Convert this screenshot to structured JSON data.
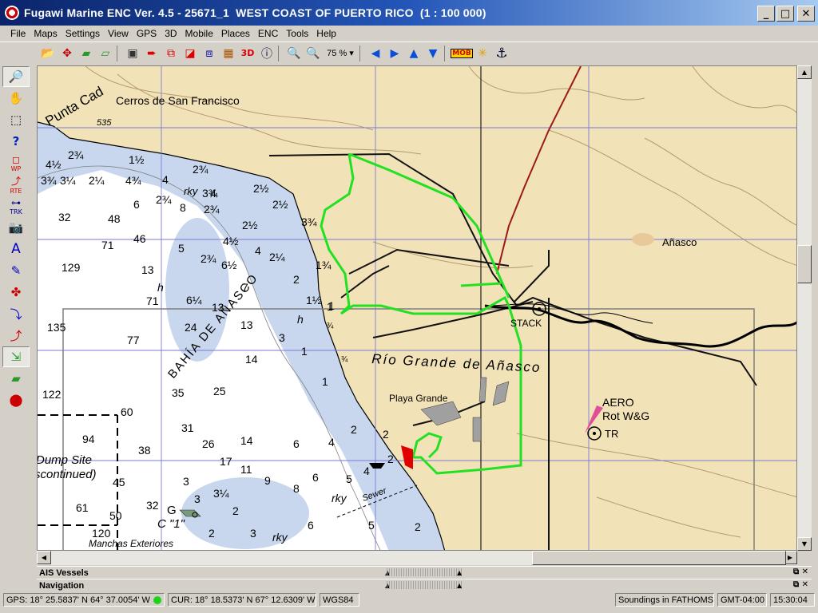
{
  "window": {
    "title": "Fugawi Marine ENC Ver. 4.5 - 25671_1  WEST COAST OF PUERTO RICO  (1 : 100 000)",
    "minimize": "_",
    "maximize": "□",
    "close": "✕"
  },
  "menu": [
    "File",
    "Maps",
    "Settings",
    "View",
    "GPS",
    "3D",
    "Mobile",
    "Places",
    "ENC",
    "Tools",
    "Help"
  ],
  "toolbar": {
    "zoom_level": "75 %",
    "zoom_caret": "▾",
    "mob_label": "MOB",
    "threed_label": "3D",
    "icons": [
      "open-folder-icon",
      "pan-cross-icon",
      "layers-icon",
      "layers-alt-icon",
      "device-icon",
      "send-red-icon",
      "route-icon",
      "waypoint-red-icon",
      "window-icon",
      "photo-icon",
      "3d-icon",
      "info-icon",
      "zoom-out-icon",
      "zoom-in-icon",
      "arrow-left-icon",
      "arrow-right-icon",
      "arrow-up-icon",
      "arrow-down-icon",
      "mob-icon",
      "spark-icon",
      "anchor-icon"
    ]
  },
  "left_tools": [
    "zoom-tool",
    "hand-tool",
    "select-tool",
    "query-tool",
    "waypoint-tool",
    "route-tool",
    "track-tool",
    "camera-tool",
    "text-tool",
    "pen-tool",
    "waypoint-add-tool",
    "route-add-tool",
    "route-edit-tool",
    "layer-tool",
    "layer2-tool",
    "gps-tool"
  ],
  "left_tool_labels": {
    "waypoint": "WP",
    "route": "RTE",
    "track": "TRK"
  },
  "map": {
    "place_names": {
      "punta": "Punta Cad",
      "cerros": "Cerros de San Francisco",
      "anasco": "Añasco",
      "rio": "Río  Grande  de  Añasco",
      "playa": "Playa Grande",
      "bahia": "BAHÍA  DE  AÑASCO",
      "stack": "STACK",
      "aero": "AERO",
      "rot": "Rot W&G",
      "tr": "TR",
      "dump1": "Dump Site",
      "dump2": "scontinued)",
      "sewer": "Sewer",
      "manchas": "Manchas Exteriores",
      "buoy_g": "G",
      "buoy_c": "C \"1\"",
      "rky1": "rky",
      "rky2": "rky",
      "rky3": "rky",
      "h1": "h",
      "h2": "h",
      "elev535": "535"
    },
    "soundings": [
      "4½",
      "2¾",
      "1½",
      "3¾",
      "3¼",
      "2¼",
      "4¾",
      "4",
      "2¾",
      "2¾",
      "32",
      "48",
      "6",
      "2¾",
      "8",
      "3¾",
      "4",
      "2½",
      "2½",
      "46",
      "71",
      "5",
      "4½",
      "2½",
      "2¾",
      "3¾",
      "129",
      "13",
      "6½",
      "4",
      "2¼",
      "1¾",
      "71",
      "7",
      "2",
      "1½",
      "1",
      "135",
      "77",
      "6¼",
      "13",
      "24",
      "13",
      "3",
      "1",
      "¾",
      "14",
      "¾",
      "122",
      "35",
      "25",
      "1",
      "60",
      "94",
      "31",
      "26",
      "14",
      "6",
      "4",
      "2",
      "2",
      "38",
      "17",
      "11",
      "45",
      "9",
      "8",
      "6",
      "5",
      "4",
      "2",
      "61",
      "32",
      "3",
      "3¼",
      "3",
      "2",
      "6",
      "5",
      "120",
      "2",
      "3",
      "2",
      "50",
      "1"
    ],
    "soundings_units_caption": ""
  },
  "panels": {
    "ais": "AIS Vessels",
    "nav": "Navigation"
  },
  "status": {
    "gps": "GPS: 18° 25.5837' N 64° 37.0054' W",
    "cur": "CUR: 18° 18.5373' N 67° 12.6309' W",
    "datum": "WGS84",
    "soundings": "Soundings in FATHOMS",
    "tz": "GMT-04:00",
    "time": "15:30:04"
  },
  "colors": {
    "land": "#f2e2b8",
    "shallow": "#c8d7ee",
    "deep": "#ffffff",
    "track": "#22e022",
    "grid": "#7a7ad6"
  }
}
